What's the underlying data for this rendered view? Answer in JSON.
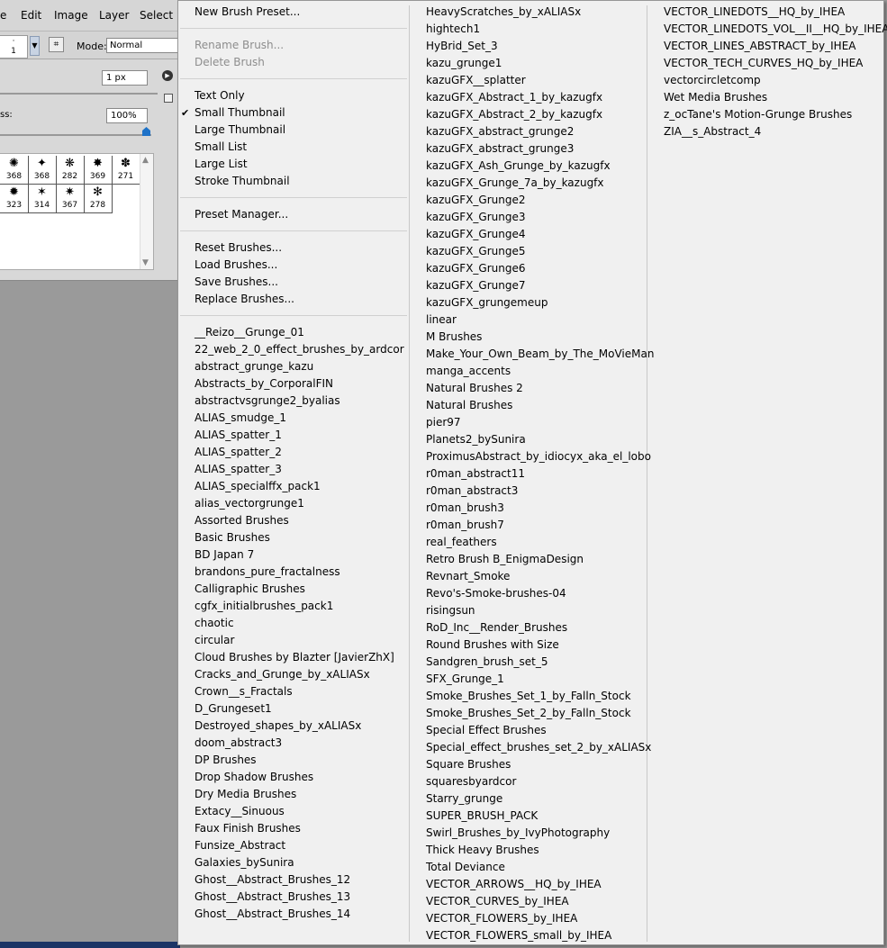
{
  "menubar": {
    "items": [
      "e",
      "Edit",
      "Image",
      "Layer",
      "Select"
    ]
  },
  "options_bar": {
    "brush_size_value": "1",
    "mode_label": "Mode:",
    "mode_value": "Normal"
  },
  "brush_panel": {
    "size_value": "1 px",
    "hardness_label": "ss:",
    "hardness_value": "100%",
    "hardness_level_percent": 100,
    "brush_sizes": [
      "368",
      "368",
      "282",
      "369",
      "271",
      "323",
      "314",
      "367",
      "278"
    ]
  },
  "menu": {
    "col1": {
      "group1": [
        {
          "label": "New Brush Preset...",
          "disabled": false
        }
      ],
      "group2": [
        {
          "label": "Rename Brush...",
          "disabled": true
        },
        {
          "label": "Delete Brush",
          "disabled": true
        }
      ],
      "group3": [
        {
          "label": "Text Only",
          "checked": false
        },
        {
          "label": "Small Thumbnail",
          "checked": true
        },
        {
          "label": "Large Thumbnail",
          "checked": false
        },
        {
          "label": "Small List",
          "checked": false
        },
        {
          "label": "Large List",
          "checked": false
        },
        {
          "label": "Stroke Thumbnail",
          "checked": false
        }
      ],
      "group4": [
        {
          "label": "Preset Manager..."
        }
      ],
      "group5": [
        {
          "label": "Reset Brushes..."
        },
        {
          "label": "Load Brushes..."
        },
        {
          "label": "Save Brushes..."
        },
        {
          "label": "Replace Brushes..."
        }
      ],
      "libraries": [
        "__Reizo__Grunge_01",
        "22_web_2_0_effect_brushes_by_ardcor",
        "abstract_grunge_kazu",
        "Abstracts_by_CorporalFIN",
        "abstractvsgrunge2_byalias",
        "ALIAS_smudge_1",
        "ALIAS_spatter_1",
        "ALIAS_spatter_2",
        "ALIAS_spatter_3",
        "ALIAS_specialffx_pack1",
        "alias_vectorgrunge1",
        "Assorted Brushes",
        "Basic Brushes",
        "BD Japan 7",
        "brandons_pure_fractalness",
        "Calligraphic Brushes",
        "cgfx_initialbrushes_pack1",
        "chaotic",
        "circular",
        "Cloud Brushes by Blazter [JavierZhX]",
        "Cracks_and_Grunge_by_xALIASx",
        "Crown__s_Fractals",
        "D_Grungeset1",
        "Destroyed_shapes_by_xALIASx",
        "doom_abstract3",
        "DP Brushes",
        "Drop Shadow Brushes",
        "Dry Media Brushes",
        "Extacy__Sinuous",
        "Faux Finish Brushes",
        "Funsize_Abstract",
        "Galaxies_bySunira",
        "Ghost__Abstract_Brushes_12",
        "Ghost__Abstract_Brushes_13",
        "Ghost__Abstract_Brushes_14"
      ]
    },
    "col2": [
      "HeavyScratches_by_xALIASx",
      "hightech1",
      "HyBrid_Set_3",
      "kazu_grunge1",
      "kazuGFX__splatter",
      "kazuGFX_Abstract_1_by_kazugfx",
      "kazuGFX_Abstract_2_by_kazugfx",
      "kazuGFX_abstract_grunge2",
      "kazuGFX_abstract_grunge3",
      "kazuGFX_Ash_Grunge_by_kazugfx",
      "kazuGFX_Grunge_7a_by_kazugfx",
      "kazuGFX_Grunge2",
      "kazuGFX_Grunge3",
      "kazuGFX_Grunge4",
      "kazuGFX_Grunge5",
      "kazuGFX_Grunge6",
      "kazuGFX_Grunge7",
      "kazuGFX_grungemeup",
      "linear",
      "M Brushes",
      "Make_Your_Own_Beam_by_The_MoVieMan",
      "manga_accents",
      "Natural Brushes 2",
      "Natural Brushes",
      "pier97",
      "Planets2_bySunira",
      "ProximusAbstract_by_idiocyx_aka_el_lobo",
      "r0man_abstract11",
      "r0man_abstract3",
      "r0man_brush3",
      "r0man_brush7",
      "real_feathers",
      "Retro Brush B_EnigmaDesign",
      "Revnart_Smoke",
      "Revo's-Smoke-brushes-04",
      "risingsun",
      "RoD_Inc__Render_Brushes",
      "Round Brushes with Size",
      "Sandgren_brush_set_5",
      "SFX_Grunge_1",
      "Smoke_Brushes_Set_1_by_Falln_Stock",
      "Smoke_Brushes_Set_2_by_Falln_Stock",
      "Special Effect Brushes",
      "Special_effect_brushes_set_2_by_xALIASx",
      "Square Brushes",
      "squaresbyardcor",
      "Starry_grunge",
      "SUPER_BRUSH_PACK",
      "Swirl_Brushes_by_IvyPhotography",
      "Thick Heavy Brushes",
      "Total Deviance",
      "VECTOR_ARROWS__HQ_by_IHEA",
      "VECTOR_CURVES_by_IHEA",
      "VECTOR_FLOWERS_by_IHEA",
      "VECTOR_FLOWERS_small_by_IHEA"
    ],
    "col3": [
      "VECTOR_LINEDOTS__HQ_by_IHEA",
      "VECTOR_LINEDOTS_VOL__II__HQ_by_IHEA",
      "VECTOR_LINES_ABSTRACT_by_IHEA",
      "VECTOR_TECH_CURVES_HQ_by_IHEA",
      "vectorcircletcomp",
      "Wet Media Brushes",
      "z_ocTane's Motion-Grunge Brushes",
      "ZIA__s_Abstract_4"
    ]
  }
}
